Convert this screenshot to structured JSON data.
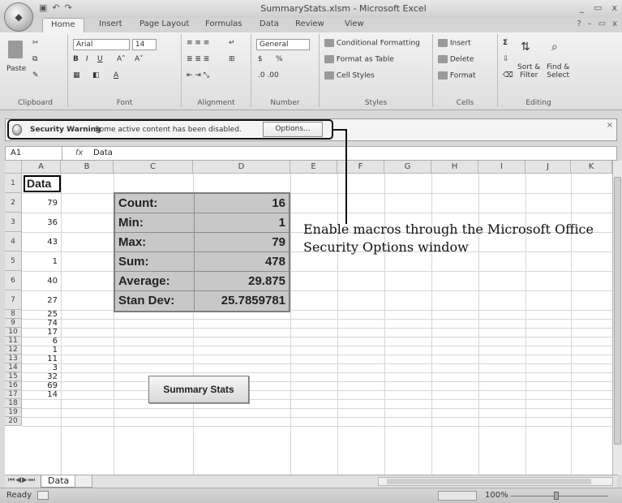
{
  "window": {
    "title": "SummaryStats.xlsm - Microsoft Excel",
    "controls": [
      "_",
      "▭",
      "x"
    ]
  },
  "ribbon": {
    "tabs": [
      "Home",
      "Insert",
      "Page Layout",
      "Formulas",
      "Data",
      "Review",
      "View"
    ],
    "clipboard": {
      "label": "Clipboard",
      "paste": "Paste"
    },
    "font": {
      "label": "Font",
      "name": "Arial",
      "size": "14",
      "bold": "B",
      "italic": "I",
      "underline": "U"
    },
    "alignment": {
      "label": "Alignment"
    },
    "number": {
      "label": "Number",
      "format": "General",
      "currency": "$",
      "percent": "%"
    },
    "styles": {
      "label": "Styles",
      "conditional": "Conditional Formatting",
      "format_table": "Format as Table",
      "cell_styles": "Cell Styles"
    },
    "cells": {
      "label": "Cells",
      "insert": "Insert",
      "delete": "Delete",
      "format": "Format"
    },
    "editing": {
      "label": "Editing",
      "sort": "Sort &",
      "filter": "Filter",
      "find": "Find &",
      "select": "Select"
    }
  },
  "security": {
    "title": "Security Warning",
    "message": "Some active content has been disabled.",
    "options_button": "Options..."
  },
  "formula_bar": {
    "name_box": "A1",
    "fx": "fx",
    "value": "Data"
  },
  "columns": [
    "A",
    "B",
    "C",
    "D",
    "E",
    "F",
    "G",
    "H",
    "I",
    "J",
    "K"
  ],
  "rows": [
    "1",
    "2",
    "3",
    "4",
    "5",
    "6",
    "7",
    "8",
    "9",
    "10",
    "11",
    "12",
    "13",
    "14",
    "15",
    "16",
    "17",
    "18",
    "19",
    "20"
  ],
  "column_a": {
    "header": "Data",
    "values": [
      "79",
      "36",
      "43",
      "1",
      "40",
      "27",
      "25",
      "74",
      "17",
      "6",
      "1",
      "11",
      "3",
      "32",
      "69",
      "14"
    ]
  },
  "stats": [
    {
      "label": "Count:",
      "value": "16"
    },
    {
      "label": "Min:",
      "value": "1"
    },
    {
      "label": "Max:",
      "value": "79"
    },
    {
      "label": "Sum:",
      "value": "478"
    },
    {
      "label": "Average:",
      "value": "29.875"
    },
    {
      "label": "Stan Dev:",
      "value": "25.7859781"
    }
  ],
  "summary_button": "Summary Stats",
  "callout": "Enable macros through the Microsoft Office Security Options window",
  "sheet": {
    "tab": "Data"
  },
  "status": {
    "ready": "Ready",
    "zoom": "100%"
  }
}
